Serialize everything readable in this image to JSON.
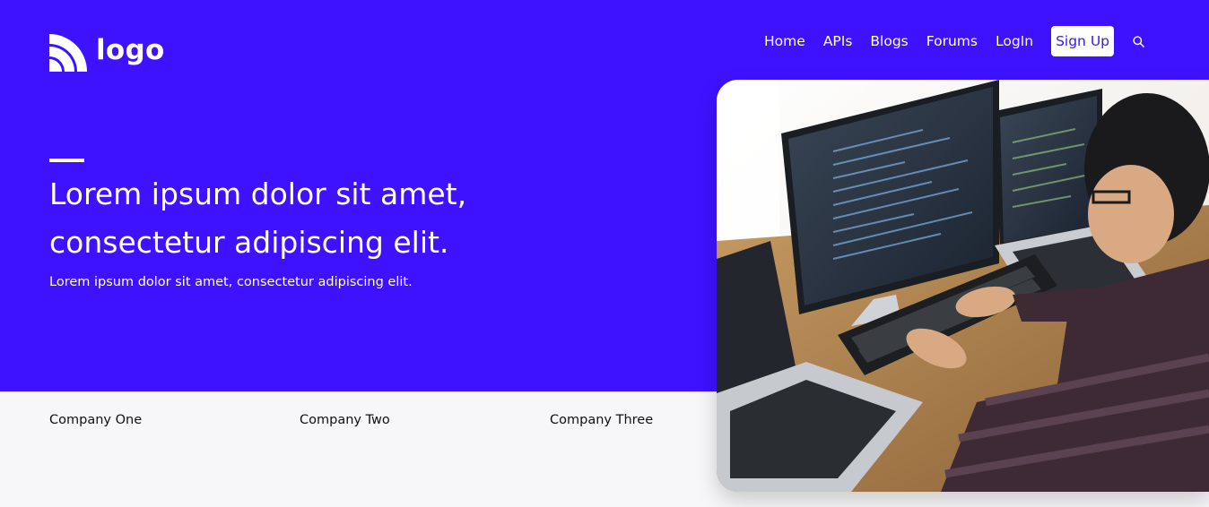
{
  "brand": {
    "logo_text": "logo"
  },
  "nav": {
    "links": [
      "Home",
      "APIs",
      "Blogs",
      "Forums",
      "LogIn"
    ],
    "signup_label": "Sign Up",
    "search_icon": "search-icon"
  },
  "hero": {
    "headline": "Lorem ipsum dolor sit amet, consectetur adipiscing elit.",
    "subtext": "Lorem ipsum dolor sit amet, consectetur adipiscing elit.",
    "image_subject": "developer-coding-photo"
  },
  "companies": [
    "Company One",
    "Company Two",
    "Company Three"
  ],
  "colors": {
    "primary": "#3d12ff",
    "surface": "#f7f7f9",
    "text_dark": "#111111",
    "white": "#ffffff"
  }
}
